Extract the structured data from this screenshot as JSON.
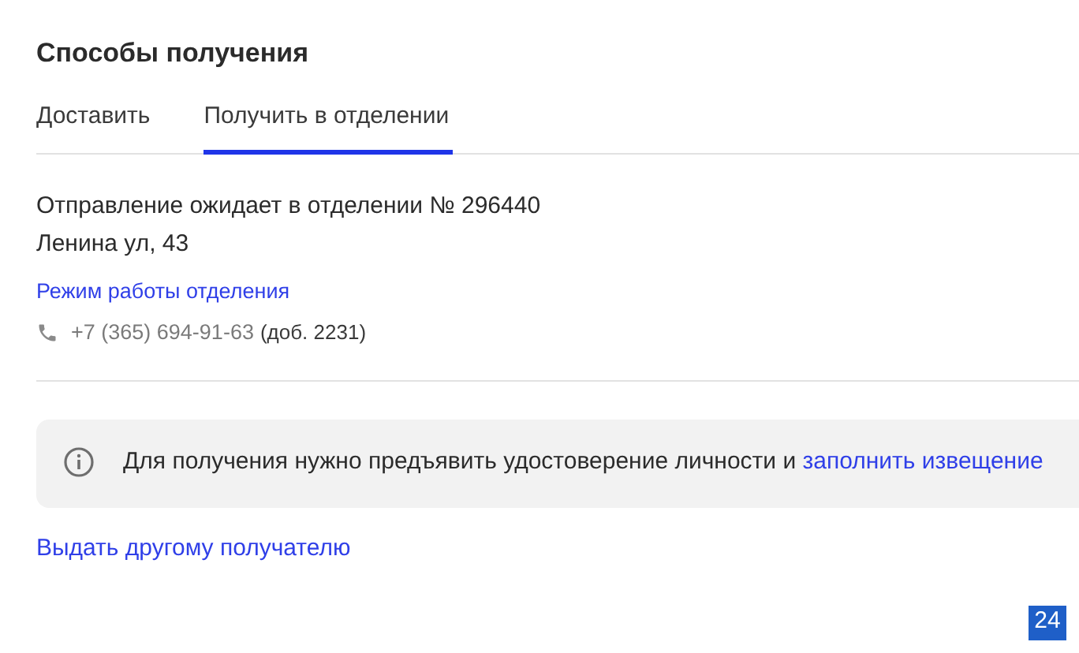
{
  "title": "Способы получения",
  "tabs": [
    {
      "label": "Доставить",
      "selected": false
    },
    {
      "label": "Получить в отделении",
      "selected": true
    }
  ],
  "branch": {
    "status": "Отправление ожидает в отделении № 296440",
    "address": "Ленина ул, 43",
    "hours_link": "Режим работы отделения",
    "phone": "+7 (365) 694-91-63",
    "extension": "(доб. 2231)"
  },
  "notice": {
    "text": "Для получения нужно предъявить удостоверение личности и",
    "link": "заполнить извещение"
  },
  "other_recipient_link": "Выдать другому получателю",
  "badge": "24"
}
